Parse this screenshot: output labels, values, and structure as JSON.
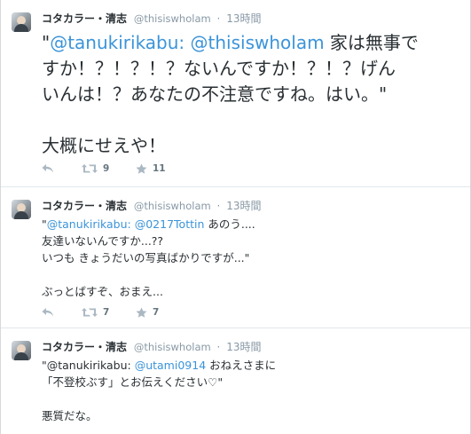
{
  "tweets": [
    {
      "fullname": "コタカラー・清志",
      "screen_name": "@thisiswholam",
      "separator": "·",
      "time": "13時間",
      "text": {
        "open_quote": "\"",
        "mention1": "@tanukirikabu:",
        "mention2": "@thisiswholam",
        "line1_rest": " 家は無事で",
        "line2": "すか！？！？！？ないんですか！？！？げん",
        "line3": "いんは！？あなたの不注意ですね。はい。\"",
        "line5": "大概にせえや！"
      },
      "retweets": "9",
      "favorites": "11",
      "icons": [
        "reply-icon",
        "retweet-icon",
        "favorite-icon"
      ]
    },
    {
      "fullname": "コタカラー・清志",
      "screen_name": "@thisiswholam",
      "separator": "·",
      "time": "13時間",
      "text": {
        "open_quote": "\"",
        "mention1": "@tanukirikabu:",
        "mention2": "@0217Tottin",
        "line1_rest": " あのう....",
        "line2": "友達いないんですか...??",
        "line3": "いつも きょうだいの写真ばかりですが...\"",
        "line5": "ぶっとばすぞ、おまえ..."
      },
      "retweets": "7",
      "favorites": "7"
    },
    {
      "fullname": "コタカラー・清志",
      "screen_name": "@thisiswholam",
      "separator": "·",
      "time": "13時間",
      "text": {
        "line1_start": "\"@tanukirikabu: ",
        "mention2": "@utami0914",
        "line1_rest": " おねえさまに",
        "line2": "「不登校ぶす」とお伝えください♡\"",
        "line4": "悪質だな。"
      }
    }
  ],
  "colors": {
    "link": "#3b94d9",
    "muted": "#8899a6",
    "text": "#292f33"
  }
}
